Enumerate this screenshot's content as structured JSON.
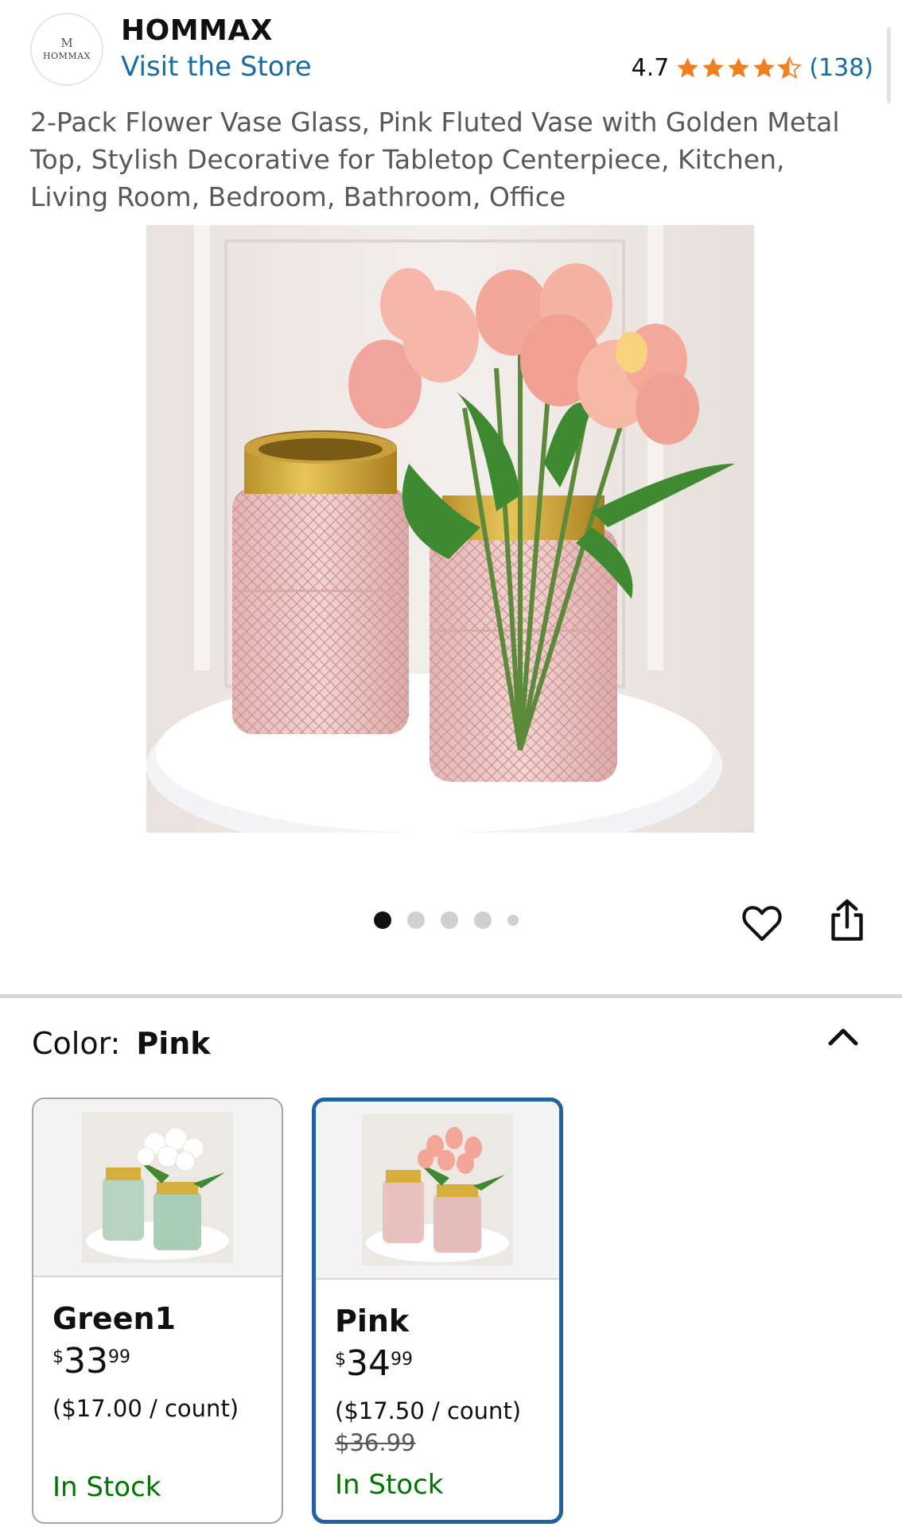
{
  "brand": {
    "logo_mark": "M",
    "logo_word": "HOMMAX",
    "name": "HOMMAX",
    "visit_store": "Visit the Store"
  },
  "rating": {
    "value": "4.7",
    "stars": 4.5,
    "count": "(138)",
    "star_color": "#f17f20"
  },
  "product": {
    "title": "2-Pack Flower Vase Glass, Pink Fluted Vase with Golden Metal Top, Stylish Decorative for Tabletop Centerpiece, Kitchen, Living Room, Bedroom, Bathroom, Office"
  },
  "gallery": {
    "image_count": 5,
    "active_index": 0
  },
  "actions": {
    "wishlist_icon": "heart-icon",
    "share_icon": "share-icon"
  },
  "color_selector": {
    "label": "Color:",
    "selected": "Pink",
    "collapse_icon": "chevron-up-icon"
  },
  "variants": [
    {
      "name": "Green1",
      "currency": "$",
      "price_whole": "33",
      "price_fraction": "99",
      "unit_price": "($17.00 / count)",
      "list_price": "",
      "stock": "In Stock",
      "selected": false
    },
    {
      "name": "Pink",
      "currency": "$",
      "price_whole": "34",
      "price_fraction": "99",
      "unit_price": "($17.50 / count)",
      "list_price": "$36.99",
      "stock": "In Stock",
      "selected": true
    }
  ],
  "colors": {
    "link": "#1a6ba0",
    "in_stock": "#007600",
    "selected_border": "#2162a1"
  }
}
